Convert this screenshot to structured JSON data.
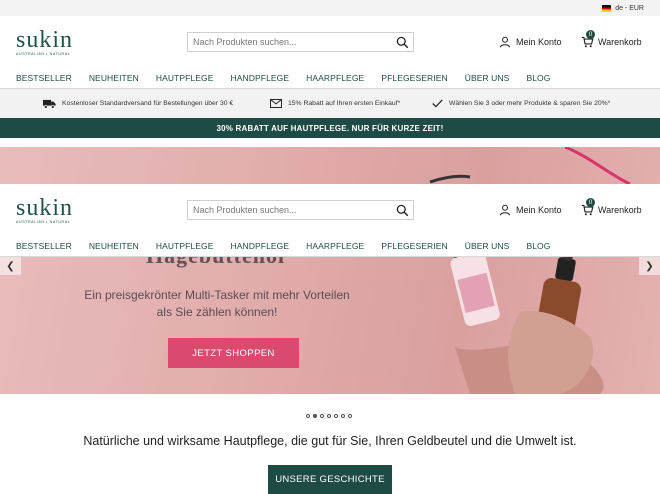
{
  "topbar": {
    "locale": "de - EUR"
  },
  "header": {
    "logo_text": "sukin",
    "logo_tagline": "AUSTRALIAN • NATURAL",
    "search_placeholder": "Nach Produkten suchen...",
    "account_label": "Mein Konto",
    "cart_label": "Warenkorb",
    "cart_count": "0"
  },
  "nav": [
    "BESTSELLER",
    "NEUHEITEN",
    "HAUTPFLEGE",
    "HANDPFLEGE",
    "HAARPFLEGE",
    "PFLEGESERIEN",
    "ÜBER UNS",
    "BLOG"
  ],
  "benefits": [
    {
      "icon": "truck-icon",
      "text": "Kostenloser Standardversand für Bestellungen über 30 €"
    },
    {
      "icon": "envelope-icon",
      "text": "15% Rabatt auf Ihren ersten Einkauf*"
    },
    {
      "icon": "checkmark-icon",
      "text": "Wählen Sie 3 oder mehr Produkte & sparen Sie 20%*"
    }
  ],
  "promo": "30% RABATT AUF HAUTPFLEGE. NUR FÜR KURZE ZEIT!",
  "hero": {
    "title_fragment": "Hagebuttenöl",
    "subtitle": "Ein preisgekrönter Multi-Tasker mit mehr Vorteilen als Sie zählen können!",
    "cta": "JETZT SHOPPEN",
    "slide_count": 7,
    "active_slide": 1
  },
  "tagline": "Natürliche und wirksame Hautpflege, die gut für Sie, Ihren Geldbeutel und die Umwelt ist.",
  "story_button": "UNSERE GESCHICHTE",
  "colors": {
    "brand_green": "#1e4b44",
    "cta_pink": "#d94a6e",
    "hero_bg": "#e2aeae"
  }
}
